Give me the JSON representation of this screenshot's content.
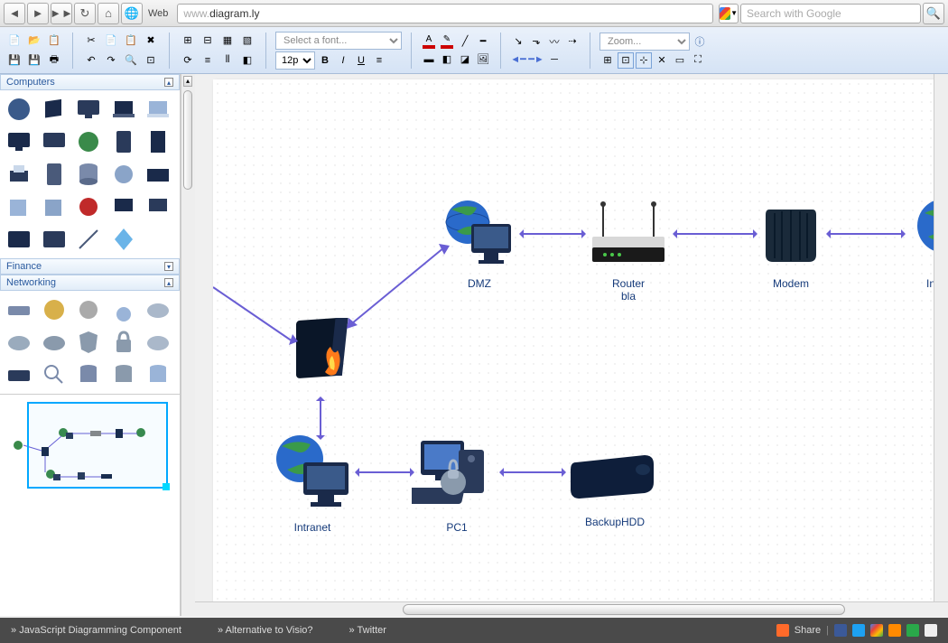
{
  "browser": {
    "url_host": "www.",
    "url_domain": "diagram.ly",
    "web_label": "Web",
    "search_placeholder": "Search with Google"
  },
  "toolbar": {
    "font_placeholder": "Select a font...",
    "size_value": "12pt",
    "zoom_placeholder": "Zoom...",
    "bold": "B",
    "italic": "I",
    "underline": "U"
  },
  "palettes": {
    "computers": "Computers",
    "finance": "Finance",
    "networking": "Networking"
  },
  "nodes": {
    "dmz": "DMZ",
    "router": "Router\nbla",
    "modem": "Modem",
    "internet": "Inte",
    "firewall": "",
    "intranet": "Intranet",
    "pc1": "PC1",
    "backup": "BackupHDD"
  },
  "footer": {
    "link1": "JavaScript Diagramming Component",
    "link2": "Alternative to Visio?",
    "link3": "Twitter",
    "share": "Share"
  }
}
